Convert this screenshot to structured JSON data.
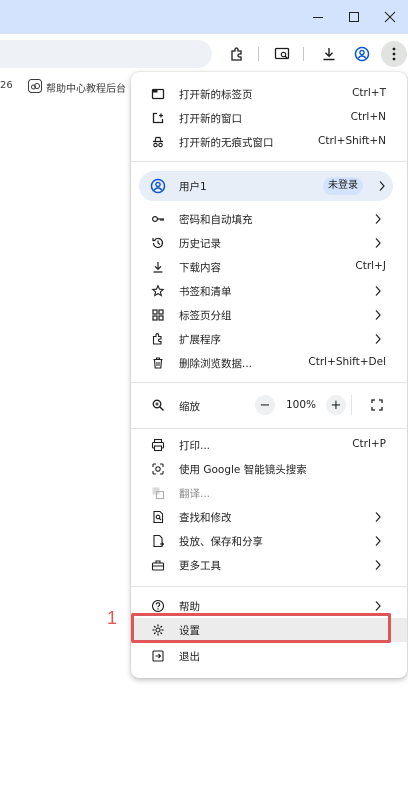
{
  "bookmarks": {
    "partial_text": "26",
    "item": "帮助中心教程后台"
  },
  "menu": {
    "new_tab": {
      "label": "打开新的标签页",
      "shortcut": "Ctrl+T"
    },
    "new_window": {
      "label": "打开新的窗口",
      "shortcut": "Ctrl+N"
    },
    "incognito": {
      "label": "打开新的无痕式窗口",
      "shortcut": "Ctrl+Shift+N"
    },
    "profile": {
      "name": "用户1",
      "status": "未登录"
    },
    "passwords": {
      "label": "密码和自动填充"
    },
    "history": {
      "label": "历史记录"
    },
    "downloads": {
      "label": "下载内容",
      "shortcut": "Ctrl+J"
    },
    "bookmarks": {
      "label": "书签和清单"
    },
    "tab_groups": {
      "label": "标签页分组"
    },
    "extensions": {
      "label": "扩展程序"
    },
    "clear_data": {
      "label": "删除浏览数据...",
      "shortcut": "Ctrl+Shift+Del"
    },
    "zoom": {
      "label": "缩放",
      "value": "100%",
      "minus": "−",
      "plus": "+"
    },
    "print": {
      "label": "打印...",
      "shortcut": "Ctrl+P"
    },
    "lens": {
      "label": "使用 Google 智能镜头搜索"
    },
    "translate": {
      "label": "翻译..."
    },
    "find": {
      "label": "查找和修改"
    },
    "cast": {
      "label": "投放、保存和分享"
    },
    "more_tools": {
      "label": "更多工具"
    },
    "help": {
      "label": "帮助"
    },
    "settings": {
      "label": "设置"
    },
    "exit": {
      "label": "退出"
    }
  },
  "annotation": {
    "number": "1"
  },
  "colors": {
    "titlebar": "#d3e3fd",
    "highlight": "#e05555",
    "profile_bg": "#e8eef7"
  }
}
